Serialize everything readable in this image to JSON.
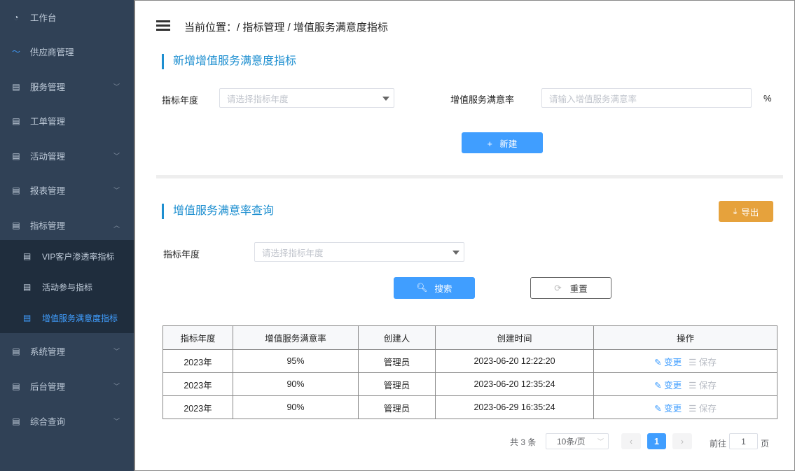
{
  "sidebar": {
    "items": [
      {
        "label": "工作台",
        "icon": "dashboard-icon"
      },
      {
        "label": "供应商管理",
        "icon": "trend-icon"
      },
      {
        "label": "服务管理",
        "icon": "document-icon",
        "expandable": true
      },
      {
        "label": "工单管理",
        "icon": "document-icon"
      },
      {
        "label": "活动管理",
        "icon": "document-icon",
        "expandable": true
      },
      {
        "label": "报表管理",
        "icon": "document-icon",
        "expandable": true
      },
      {
        "label": "指标管理",
        "icon": "document-icon",
        "expandable": true,
        "expanded": true
      },
      {
        "label": "系统管理",
        "icon": "document-icon",
        "expandable": true
      },
      {
        "label": "后台管理",
        "icon": "document-icon",
        "expandable": true
      },
      {
        "label": "综合查询",
        "icon": "document-icon",
        "expandable": true
      }
    ],
    "subitems": [
      {
        "label": "VIP客户渗透率指标"
      },
      {
        "label": "活动参与指标"
      },
      {
        "label": "增值服务满意度指标",
        "active": true
      }
    ]
  },
  "breadcrumb": "当前位置：/ 指标管理 / 增值服务满意度指标",
  "create": {
    "title": "新增增值服务满意度指标",
    "year_label": "指标年度",
    "year_placeholder": "请选择指标年度",
    "rate_label": "增值服务满意率",
    "rate_placeholder": "请输入增值服务满意率",
    "unit": "%",
    "new_button": "+   新建"
  },
  "query": {
    "title": "增值服务满意率查询",
    "export_button": "导出",
    "year_label": "指标年度",
    "year_placeholder": "请选择指标年度",
    "search_button": "搜索",
    "reset_button": "重置"
  },
  "table": {
    "headers": [
      "指标年度",
      "增值服务满意率",
      "创建人",
      "创建时间",
      "操作"
    ],
    "rows": [
      {
        "year": "2023年",
        "rate": "95%",
        "creator": "管理员",
        "time": "2023-06-20 12:22:20",
        "edit": "变更",
        "save": "保存"
      },
      {
        "year": "2023年",
        "rate": "90%",
        "creator": "管理员",
        "time": "2023-06-20 12:35:24",
        "edit": "变更",
        "save": "保存"
      },
      {
        "year": "2023年",
        "rate": "90%",
        "creator": "管理员",
        "time": "2023-06-29 16:35:24",
        "edit": "变更",
        "save": "保存"
      }
    ]
  },
  "pagination": {
    "total": "共 3 条",
    "page_size": "10条/页",
    "current": "1",
    "goto_label": "前往",
    "goto_value": "1",
    "page_unit": "页"
  },
  "colors": {
    "sidebar": "#304156",
    "accent": "#409eff",
    "export": "#e6a23c",
    "section": "#1e8fd0"
  }
}
